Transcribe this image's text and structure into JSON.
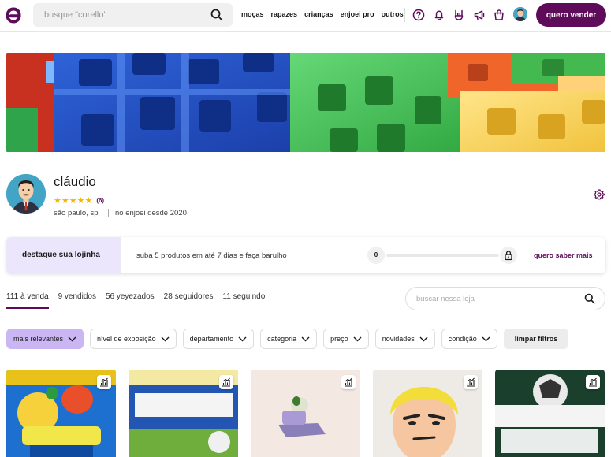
{
  "header": {
    "logo_letter": "e",
    "search_placeholder": "busque \"corello\"",
    "nav": [
      "moças",
      "rapazes",
      "crianças",
      "enjoei pro",
      "outros"
    ],
    "icons": [
      "help-icon",
      "bell-icon",
      "rock-hand-icon",
      "megaphone-icon",
      "shopping-bag-icon"
    ],
    "sell_label": "quero vender"
  },
  "profile": {
    "name": "cláudio",
    "stars": "★★★★★",
    "rating_count": "(6)",
    "location": "são paulo, sp",
    "since": "no enjoei desde 2020"
  },
  "highlight": {
    "title": "destaque sua lojinha",
    "description": "suba 5 produtos em até 7 dias e faça barulho",
    "progress_value": "0",
    "progress_fraction": 0,
    "more_label": "quero saber mais"
  },
  "tabs": [
    "111 à venda",
    "9 vendidos",
    "56 yeyezados",
    "28 seguidores",
    "11 seguindo"
  ],
  "store_search_placeholder": "buscar nessa loja",
  "filters": [
    "mais relevantes",
    "nível de exposição",
    "departamento",
    "categoria",
    "preço",
    "novidades",
    "condição"
  ],
  "clear_filters_label": "limpar filtros",
  "colors": {
    "brand": "#5e0b5a",
    "active_chip": "#c9b6f3",
    "highlight_bg": "#ebe6fb",
    "stars": "#f5b400"
  }
}
